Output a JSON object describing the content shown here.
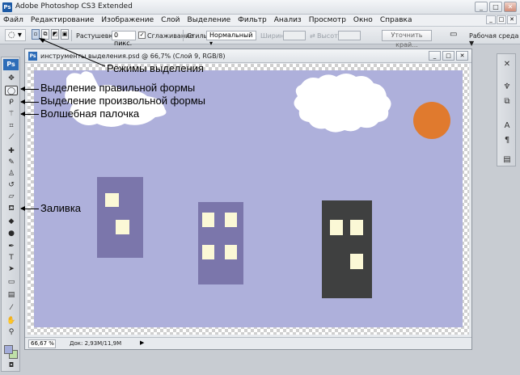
{
  "app": {
    "title": "Adobe Photoshop CS3 Extended",
    "logo_text": "Ps",
    "window_buttons": [
      "_",
      "□",
      "✕"
    ]
  },
  "menubar": {
    "items": [
      "Файл",
      "Редактирование",
      "Изображение",
      "Слой",
      "Выделение",
      "Фильтр",
      "Анализ",
      "Просмотр",
      "Окно",
      "Справка"
    ],
    "mini_buttons": [
      "_",
      "□",
      "✕"
    ]
  },
  "options": {
    "tool_glyph": "◌",
    "feather_label": "Растушевка:",
    "feather_value": "0 пикс.",
    "antialias_label": "Сглаживание",
    "antialias_checked": "✓",
    "style_label": "Стиль:",
    "style_value": "Нормальный",
    "width_label": "Ширина:",
    "height_label": "Высота:",
    "refine_label": "Уточнить край...",
    "workspace_label": "Рабочая среда ▼"
  },
  "toolbox": {
    "badge": "Ps",
    "tools": [
      {
        "name": "move-tool",
        "glyph": "✥"
      },
      {
        "name": "marquee-tool",
        "glyph": "◯"
      },
      {
        "name": "lasso-tool",
        "glyph": "ᑭ"
      },
      {
        "name": "magic-wand-tool",
        "glyph": "⚚"
      },
      {
        "name": "crop-tool",
        "glyph": "⌗"
      },
      {
        "name": "slice-tool",
        "glyph": "⟋"
      },
      {
        "name": "healing-tool",
        "glyph": "✚"
      },
      {
        "name": "brush-tool",
        "glyph": "✎"
      },
      {
        "name": "stamp-tool",
        "glyph": "♙"
      },
      {
        "name": "history-brush-tool",
        "glyph": "↺"
      },
      {
        "name": "eraser-tool",
        "glyph": "▱"
      },
      {
        "name": "paint-bucket-tool",
        "glyph": "⛾"
      },
      {
        "name": "blur-tool",
        "glyph": "◆"
      },
      {
        "name": "dodge-tool",
        "glyph": "●"
      },
      {
        "name": "pen-tool",
        "glyph": "✒"
      },
      {
        "name": "type-tool",
        "glyph": "T"
      },
      {
        "name": "path-selection-tool",
        "glyph": "➤"
      },
      {
        "name": "rectangle-tool",
        "glyph": "▭"
      },
      {
        "name": "notes-tool",
        "glyph": "▤"
      },
      {
        "name": "eyedropper-tool",
        "glyph": "⁄"
      },
      {
        "name": "hand-tool",
        "glyph": "✋"
      },
      {
        "name": "zoom-tool",
        "glyph": "⚲"
      }
    ],
    "fg_color": "#a3acd9",
    "bg_color": "#bfe0a8"
  },
  "rightpanel": {
    "icons": [
      {
        "name": "navigator-icon",
        "glyph": "✕"
      },
      {
        "name": "brushes-icon",
        "glyph": "♆"
      },
      {
        "name": "clone-source-icon",
        "glyph": "⧉"
      },
      {
        "name": "character-icon",
        "glyph": "A"
      },
      {
        "name": "paragraph-icon",
        "glyph": "¶"
      },
      {
        "name": "layers-icon",
        "glyph": "▤"
      }
    ]
  },
  "document": {
    "title": "инструменты выделения.psd @ 66,7% (Слой 9, RGB/8)",
    "buttons": [
      "_",
      "□",
      "✕"
    ],
    "zoom": "66,67 %",
    "doc_info": "Док: 2,93M/11,9M",
    "status_arrow": "▶",
    "colors": {
      "sky": "#aeb0db",
      "cloud": "#ffffff",
      "sun": "#e07a2e",
      "building_purple": "#7b76ab",
      "building_dark": "#3f4040",
      "window": "#fbf8d6"
    }
  },
  "annotations": {
    "modes": "Режимы выделения",
    "rect_select": "Выделение правильной формы",
    "free_select": "Выделение произвольной формы",
    "magic_wand": "Волшебная палочка",
    "fill": "Заливка"
  }
}
